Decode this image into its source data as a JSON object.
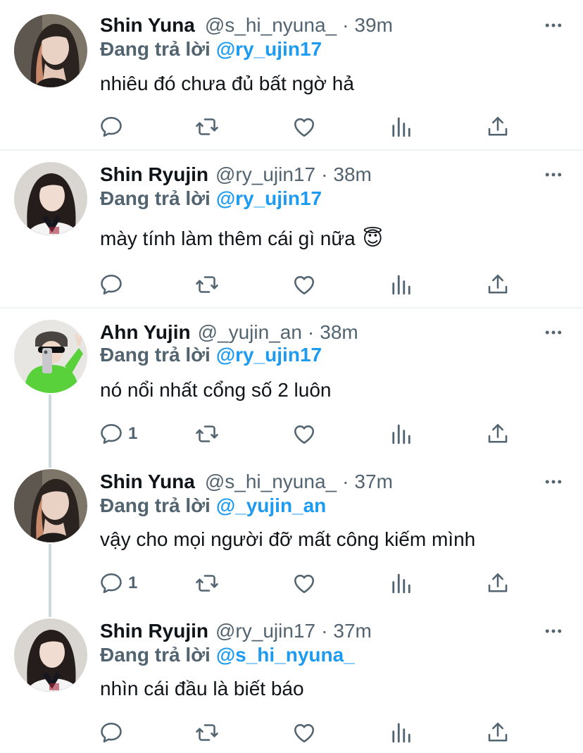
{
  "tweets": [
    {
      "name": "Shin Yuna",
      "handle": "@s_hi_nyuna_",
      "dot": "·",
      "time": "39m",
      "reply_prefix": "Đang trả lời",
      "reply_to": "@ry_ujin17",
      "text": "nhiêu đó chưa đủ bất ngờ hả",
      "reply_count": ""
    },
    {
      "name": "Shin Ryujin",
      "handle": "@ry_ujin17",
      "dot": "·",
      "time": "38m",
      "reply_prefix": "Đang trả lời",
      "reply_to": "@ry_ujin17",
      "text": "mày tính làm thêm cái gì nữa",
      "emoji": "😇",
      "reply_count": ""
    },
    {
      "name": "Ahn Yujin",
      "handle": "@_yujin_an",
      "dot": "·",
      "time": "38m",
      "reply_prefix": "Đang trả lời",
      "reply_to": "@ry_ujin17",
      "text": "nó nổi nhất cổng số 2 luôn",
      "reply_count": "1"
    },
    {
      "name": "Shin Yuna",
      "handle": "@s_hi_nyuna_",
      "dot": "·",
      "time": "37m",
      "reply_prefix": "Đang trả lời",
      "reply_to": "@_yujin_an",
      "text": "vậy cho mọi người đỡ mất công kiếm mình",
      "reply_count": "1"
    },
    {
      "name": "Shin Ryujin",
      "handle": "@ry_ujin17",
      "dot": "·",
      "time": "37m",
      "reply_prefix": "Đang trả lời",
      "reply_to": "@s_hi_nyuna_",
      "text": "nhìn cái đầu là biết báo",
      "reply_count": ""
    }
  ],
  "icons": {
    "reply": "reply-icon",
    "retweet": "retweet-icon",
    "like": "like-icon",
    "views": "views-icon",
    "share": "share-icon",
    "more": "more-icon"
  },
  "colors": {
    "link": "#1d9bf0",
    "muted": "#536471",
    "text": "#0f1419",
    "separator": "#eff3f4",
    "thread_line": "#cfd9de"
  }
}
